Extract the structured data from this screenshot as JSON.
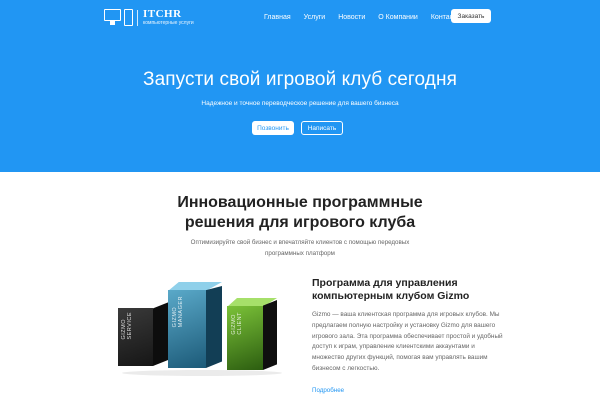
{
  "header": {
    "logo": {
      "name": "ITCHR",
      "tagline": "компьютерные услуги"
    },
    "nav": [
      "Главная",
      "Услуги",
      "Новости",
      "О Компании",
      "Контакты"
    ],
    "order_label": "Заказать"
  },
  "hero": {
    "title": "Запусти свой игровой клуб сегодня",
    "subtitle": "Надежное и точное переводческое решение для вашего бизнеса",
    "call_label": "Позвонить",
    "write_label": "Написать"
  },
  "section": {
    "title": "Инновационные программные решения для игрового клуба",
    "subtitle": "Оптимизируйте свой бизнес и впечатляйте клиентов с помощью передовых программных платформ"
  },
  "product": {
    "boxes": [
      "GIZMO SERVICE",
      "GIZMO MANAGER",
      "GIZMO CLIENT"
    ],
    "title": "Программа для управления компьютерным клубом Gizmo",
    "description": "Gizmo — ваша клиентская программа для игровых клубов. Мы предлагаем полную настройку и установку Gizmo для вашего игрового зала. Эта программа обеспечивает простой и удобный доступ к играм, управление клиентскими аккаунтами и множество других функций, помогая вам управлять вашим бизнесом с легкостью.",
    "more_label": "Подробнее"
  },
  "colors": {
    "hero_bg": "#2196f3",
    "accent": "#2196f3"
  }
}
